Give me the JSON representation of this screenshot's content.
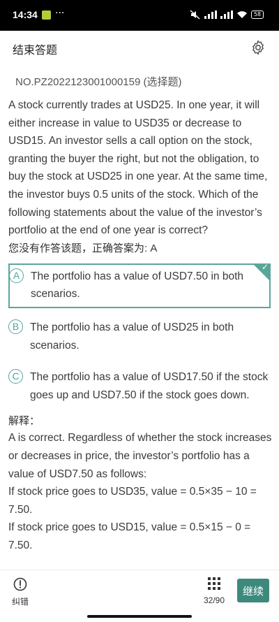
{
  "status_bar": {
    "time": "14:34",
    "dots": "···",
    "battery": "58"
  },
  "header": {
    "title": "结束答题",
    "settings_icon": "gear-icon"
  },
  "question": {
    "id": "NO.PZ2022123001000159 (选择题)",
    "stem": "A stock currently trades at USD25. In one year, it will either increase in value to USD35 or decrease to USD15. An investor sells a call option on the stock, granting the buyer the right, but not the obligation, to buy the stock at USD25 in one year. At the same time, the investor buys 0.5 units of the stock. Which of the following statements about the value of the investor’s portfolio at the end of one year is correct?",
    "no_answer_text": "您没有作答该题，正确答案为: A",
    "options": [
      {
        "letter": "A",
        "text": "The portfolio has a value of USD7.50 in both scenarios.",
        "correct": true
      },
      {
        "letter": "B",
        "text": "The portfolio has a value of USD25 in both scenarios.",
        "correct": false
      },
      {
        "letter": "C",
        "text": "The portfolio has a value of USD17.50 if the stock goes up and USD7.50 if the stock goes down.",
        "correct": false
      }
    ],
    "correct_mark": "✓"
  },
  "explanation": {
    "label": "解释：",
    "text": "A is correct. Regardless of whether the stock increases or decreases in price, the investor’s portfolio has a value of USD7.50 as follows:",
    "line1": "If stock price goes to USD35, value = 0.5×35 − 10 = 7.50.",
    "line2": "If stock price goes to USD15, value = 0.5×15 − 0 = 7.50."
  },
  "bottom_bar": {
    "report_label": "纠错",
    "page_count": "32/90",
    "continue_label": "继续"
  },
  "colors": {
    "accent": "#5aa69a",
    "button": "#3d8a7d"
  }
}
